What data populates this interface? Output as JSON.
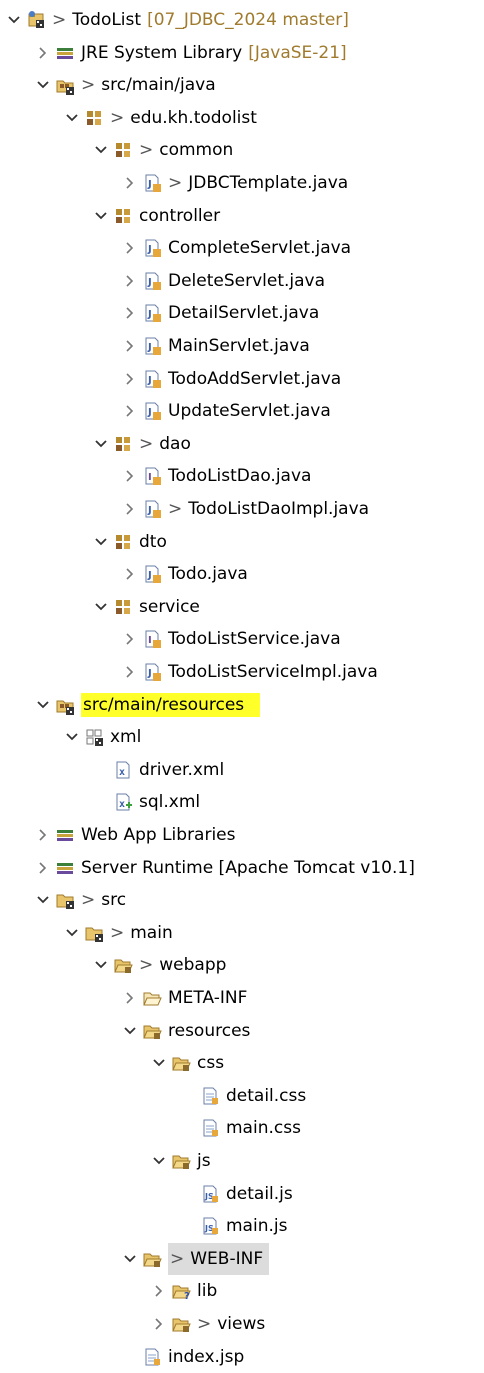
{
  "tree": [
    {
      "depth": 0,
      "toggle": "expanded",
      "icon": "project-icon",
      "decorator": ">",
      "label": "TodoList",
      "suffix": "[07_JDBC_2024 master]"
    },
    {
      "depth": 1,
      "toggle": "collapsed",
      "icon": "library-icon",
      "label": "JRE System Library",
      "suffix": "[JavaSE-21]"
    },
    {
      "depth": 1,
      "toggle": "expanded",
      "icon": "source-folder-icon",
      "decorator": ">",
      "label": "src/main/java"
    },
    {
      "depth": 2,
      "toggle": "expanded",
      "icon": "package-icon",
      "decorator": ">",
      "label": "edu.kh.todolist"
    },
    {
      "depth": 3,
      "toggle": "expanded",
      "icon": "package-icon",
      "decorator": ">",
      "label": "common"
    },
    {
      "depth": 4,
      "toggle": "collapsed",
      "icon": "java-file-icon",
      "decorator": ">",
      "label": "JDBCTemplate.java"
    },
    {
      "depth": 3,
      "toggle": "expanded",
      "icon": "package-icon",
      "label": "controller"
    },
    {
      "depth": 4,
      "toggle": "collapsed",
      "icon": "java-file-icon",
      "label": "CompleteServlet.java"
    },
    {
      "depth": 4,
      "toggle": "collapsed",
      "icon": "java-file-icon",
      "label": "DeleteServlet.java"
    },
    {
      "depth": 4,
      "toggle": "collapsed",
      "icon": "java-file-icon",
      "label": "DetailServlet.java"
    },
    {
      "depth": 4,
      "toggle": "collapsed",
      "icon": "java-file-icon",
      "label": "MainServlet.java"
    },
    {
      "depth": 4,
      "toggle": "collapsed",
      "icon": "java-file-icon",
      "label": "TodoAddServlet.java"
    },
    {
      "depth": 4,
      "toggle": "collapsed",
      "icon": "java-file-icon",
      "label": "UpdateServlet.java"
    },
    {
      "depth": 3,
      "toggle": "expanded",
      "icon": "package-icon",
      "decorator": ">",
      "label": "dao"
    },
    {
      "depth": 4,
      "toggle": "collapsed",
      "icon": "java-interface-icon",
      "label": "TodoListDao.java"
    },
    {
      "depth": 4,
      "toggle": "collapsed",
      "icon": "java-file-icon",
      "decorator": ">",
      "label": "TodoListDaoImpl.java"
    },
    {
      "depth": 3,
      "toggle": "expanded",
      "icon": "package-icon",
      "label": "dto"
    },
    {
      "depth": 4,
      "toggle": "collapsed",
      "icon": "java-file-icon",
      "label": "Todo.java"
    },
    {
      "depth": 3,
      "toggle": "expanded",
      "icon": "package-icon",
      "label": "service"
    },
    {
      "depth": 4,
      "toggle": "collapsed",
      "icon": "java-interface-icon",
      "label": "TodoListService.java"
    },
    {
      "depth": 4,
      "toggle": "collapsed",
      "icon": "java-file-icon",
      "label": "TodoListServiceImpl.java"
    },
    {
      "depth": 1,
      "toggle": "expanded",
      "icon": "source-folder-icon",
      "label": "src/main/resources",
      "highlight": "yellow"
    },
    {
      "depth": 2,
      "toggle": "expanded",
      "icon": "package-empty-icon",
      "label": "xml"
    },
    {
      "depth": 3,
      "toggle": "none",
      "icon": "xml-file-icon",
      "label": "driver.xml"
    },
    {
      "depth": 3,
      "toggle": "none",
      "icon": "xml-file-new-icon",
      "label": "sql.xml"
    },
    {
      "depth": 1,
      "toggle": "collapsed",
      "icon": "library-icon",
      "label": "Web App Libraries"
    },
    {
      "depth": 1,
      "toggle": "collapsed",
      "icon": "library-icon",
      "label": "Server Runtime [Apache Tomcat v10.1]"
    },
    {
      "depth": 1,
      "toggle": "expanded",
      "icon": "folder-git-icon",
      "decorator": ">",
      "label": "src"
    },
    {
      "depth": 2,
      "toggle": "expanded",
      "icon": "folder-git-icon",
      "decorator": ">",
      "label": "main"
    },
    {
      "depth": 3,
      "toggle": "expanded",
      "icon": "folder-open-icon",
      "decorator": ">",
      "label": "webapp"
    },
    {
      "depth": 4,
      "toggle": "collapsed",
      "icon": "folder-plain-icon",
      "label": "META-INF"
    },
    {
      "depth": 4,
      "toggle": "expanded",
      "icon": "folder-open-icon",
      "label": "resources"
    },
    {
      "depth": 5,
      "toggle": "expanded",
      "icon": "folder-open-icon",
      "label": "css"
    },
    {
      "depth": 6,
      "toggle": "none",
      "icon": "text-file-icon",
      "label": "detail.css"
    },
    {
      "depth": 6,
      "toggle": "none",
      "icon": "text-file-icon",
      "label": "main.css"
    },
    {
      "depth": 5,
      "toggle": "expanded",
      "icon": "folder-open-icon",
      "label": "js"
    },
    {
      "depth": 6,
      "toggle": "none",
      "icon": "js-file-icon",
      "label": "detail.js"
    },
    {
      "depth": 6,
      "toggle": "none",
      "icon": "js-file-icon",
      "label": "main.js"
    },
    {
      "depth": 4,
      "toggle": "expanded",
      "icon": "folder-open-icon",
      "decorator": ">",
      "label": "WEB-INF",
      "highlight": "gray"
    },
    {
      "depth": 5,
      "toggle": "collapsed",
      "icon": "folder-question-icon",
      "label": "lib"
    },
    {
      "depth": 5,
      "toggle": "collapsed",
      "icon": "folder-open-icon",
      "decorator": ">",
      "label": "views"
    },
    {
      "depth": 4,
      "toggle": "none",
      "icon": "text-file-icon",
      "label": "index.jsp"
    }
  ]
}
